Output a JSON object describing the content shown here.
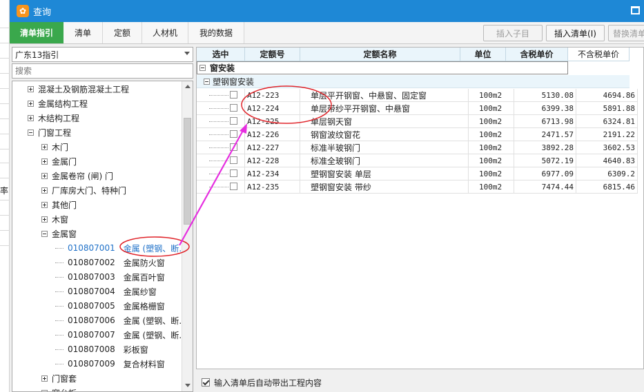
{
  "background_window": {
    "fragment_text": "率"
  },
  "window": {
    "title": "查询",
    "app_icon": "app-logo-icon",
    "maximize_icon": "maximize-icon"
  },
  "tabs": [
    {
      "label": "清单指引",
      "active": true
    },
    {
      "label": "清单",
      "active": false
    },
    {
      "label": "定额",
      "active": false
    },
    {
      "label": "人材机",
      "active": false
    },
    {
      "label": "我的数据",
      "active": false
    }
  ],
  "toolbar": {
    "insert_child_label": "插入子目",
    "insert_list_label": "插入清单(I)",
    "replace_list_label": "替换清单"
  },
  "left_panel": {
    "guide_select_value": "广东13指引",
    "search_placeholder": "搜索",
    "tree": [
      {
        "indent": 1,
        "expander": "plus",
        "label": "混凝土及钢筋混凝土工程"
      },
      {
        "indent": 1,
        "expander": "plus",
        "label": "金属结构工程"
      },
      {
        "indent": 1,
        "expander": "plus",
        "label": "木结构工程"
      },
      {
        "indent": 1,
        "expander": "minus",
        "label": "门窗工程"
      },
      {
        "indent": 2,
        "expander": "plus",
        "label": "木门"
      },
      {
        "indent": 2,
        "expander": "plus",
        "label": "金属门"
      },
      {
        "indent": 2,
        "expander": "plus",
        "label": "金属卷帘 (闸) 门"
      },
      {
        "indent": 2,
        "expander": "plus",
        "label": "厂库房大门、特种门"
      },
      {
        "indent": 2,
        "expander": "plus",
        "label": "其他门"
      },
      {
        "indent": 2,
        "expander": "plus",
        "label": "木窗"
      },
      {
        "indent": 2,
        "expander": "minus",
        "label": "金属窗"
      },
      {
        "indent": 3,
        "code": "010807001",
        "label": "金属 (塑钢、断…",
        "selected": true
      },
      {
        "indent": 3,
        "code": "010807002",
        "label": "金属防火窗"
      },
      {
        "indent": 3,
        "code": "010807003",
        "label": "金属百叶窗"
      },
      {
        "indent": 3,
        "code": "010807004",
        "label": "金属纱窗"
      },
      {
        "indent": 3,
        "code": "010807005",
        "label": "金属格栅窗"
      },
      {
        "indent": 3,
        "code": "010807006",
        "label": "金属 (塑钢、断…"
      },
      {
        "indent": 3,
        "code": "010807007",
        "label": "金属 (塑钢、断…"
      },
      {
        "indent": 3,
        "code": "010807008",
        "label": "彩板窗"
      },
      {
        "indent": 3,
        "code": "010807009",
        "label": "复合材料窗"
      },
      {
        "indent": 2,
        "expander": "plus",
        "label": "门窗套"
      },
      {
        "indent": 2,
        "expander": "plus",
        "label": "窗台板"
      }
    ]
  },
  "table": {
    "columns": [
      "选中",
      "定额号",
      "定额名称",
      "单位",
      "含税单价",
      "不含税单价"
    ],
    "group_label": "窗安装",
    "subgroup_label": "塑钢窗安装",
    "rows": [
      {
        "code": "A12-223",
        "name": "单层平开钢窗、中悬窗、固定窗",
        "unit": "100m2",
        "price_tax": "5130.08",
        "price_notax": "4694.86"
      },
      {
        "code": "A12-224",
        "name": "单层带纱平开钢窗、中悬窗",
        "unit": "100m2",
        "price_tax": "6399.38",
        "price_notax": "5891.88"
      },
      {
        "code": "A12-225",
        "name": "单层钢天窗",
        "unit": "100m2",
        "price_tax": "6713.98",
        "price_notax": "6324.81"
      },
      {
        "code": "A12-226",
        "name": "钢窗波纹窗花",
        "unit": "100m2",
        "price_tax": "2471.57",
        "price_notax": "2191.22"
      },
      {
        "code": "A12-227",
        "name": "标准半玻钢门",
        "unit": "100m2",
        "price_tax": "3892.28",
        "price_notax": "3602.53"
      },
      {
        "code": "A12-228",
        "name": "标准全玻钢门",
        "unit": "100m2",
        "price_tax": "5072.19",
        "price_notax": "4640.83"
      },
      {
        "code": "A12-234",
        "name": "塑钢窗安装 单层",
        "unit": "100m2",
        "price_tax": "6977.09",
        "price_notax": "6309.2"
      },
      {
        "code": "A12-235",
        "name": "塑钢窗安装 带纱",
        "unit": "100m2",
        "price_tax": "7474.44",
        "price_notax": "6815.46"
      }
    ]
  },
  "footer": {
    "auto_bring_label": "输入清单后自动带出工程内容",
    "auto_bring_checked": true
  },
  "annotation": {
    "ellipse_color": "#e0242a",
    "arrow_color": "#e62ee0"
  }
}
